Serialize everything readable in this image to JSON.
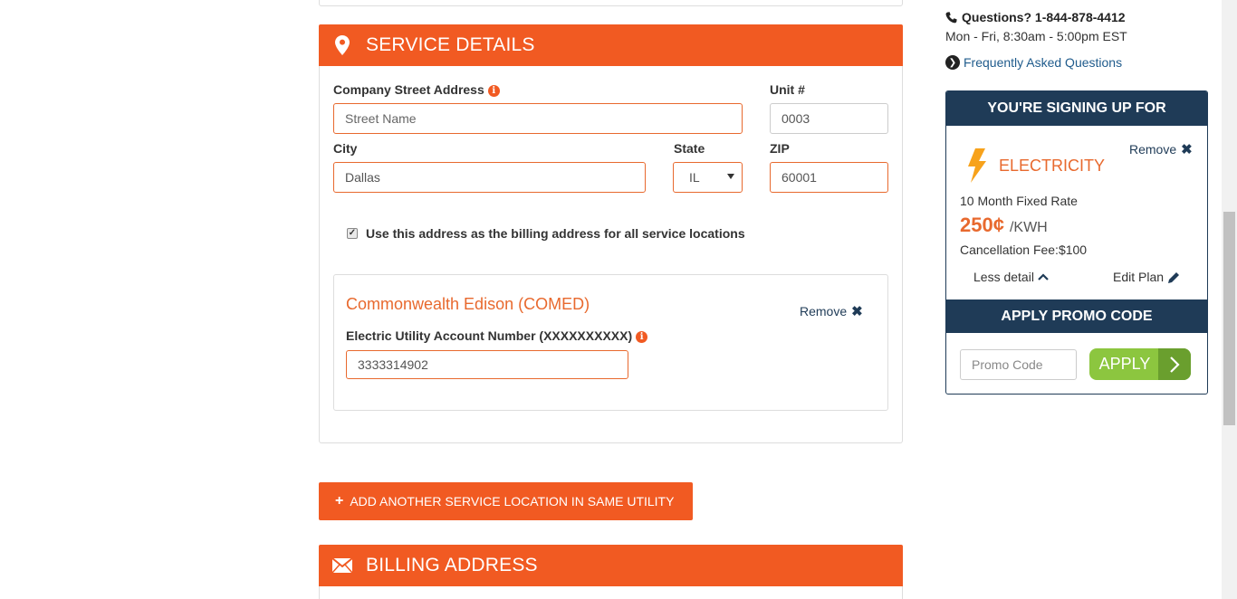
{
  "service_section": {
    "title": "SERVICE DETAILS",
    "street_label": "Company Street Address",
    "street_placeholder": "Street Name",
    "unit_label": "Unit #",
    "unit_value": "0003",
    "city_label": "City",
    "city_value": "Dallas",
    "state_label": "State",
    "state_value": "IL",
    "zip_label": "ZIP",
    "zip_value": "60001",
    "billing_checkbox_label": "Use this address as the billing address for all service locations",
    "billing_checkbox_checked": true
  },
  "utility": {
    "name": "Commonwealth Edison (COMED)",
    "remove_label": "Remove",
    "account_label": "Electric Utility Account Number (XXXXXXXXXX)",
    "account_value": "3333314902"
  },
  "add_location_button": "ADD ANOTHER SERVICE LOCATION IN SAME UTILITY",
  "billing_section": {
    "title": "BILLING ADDRESS"
  },
  "sidebar": {
    "questions_label": "Questions?",
    "phone": "1-844-878-4412",
    "hours": "Mon - Fri, 8:30am - 5:00pm EST",
    "faq_link": "Frequently Asked Questions"
  },
  "cart": {
    "title": "YOU'RE SIGNING UP FOR",
    "remove_label": "Remove",
    "plan_name": "ELECTRICITY",
    "rate_type": "10 Month Fixed Rate",
    "price": "250¢",
    "price_unit": "/KWH",
    "cancellation_fee": "Cancellation Fee:$100",
    "less_detail": "Less detail",
    "edit_plan": "Edit Plan",
    "promo_title": "APPLY PROMO CODE",
    "promo_placeholder": "Promo Code",
    "apply_label": "APPLY"
  },
  "colors": {
    "accent": "#f15a22",
    "navy": "#1f3b57",
    "green": "#8cc63f"
  }
}
